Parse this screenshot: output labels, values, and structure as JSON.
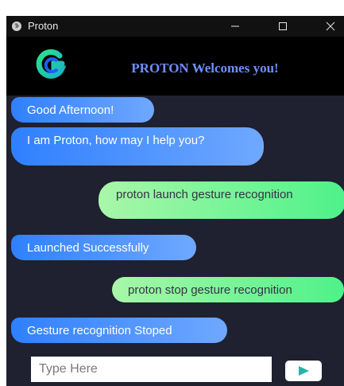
{
  "window": {
    "title": "Proton",
    "controls": {
      "minimize": "—",
      "maximize": "☐",
      "close": "✕"
    }
  },
  "header": {
    "welcome": "PROTON Welcomes you!",
    "logo_icon": "proton-logo-icon",
    "colors": {
      "welcome": "#6f8fff",
      "logo_green": "#2fe08a",
      "logo_blue": "#1e5eff"
    }
  },
  "messages": [
    {
      "sender": "bot",
      "text": "Good Afternoon!"
    },
    {
      "sender": "bot",
      "text": "I am Proton, how may I help you?"
    },
    {
      "sender": "user",
      "text": "proton launch gesture recognition"
    },
    {
      "sender": "bot",
      "text": "Launched Successfully"
    },
    {
      "sender": "user",
      "text": "proton stop gesture recognition"
    },
    {
      "sender": "bot",
      "text": "Gesture recognition Stoped"
    }
  ],
  "input": {
    "placeholder": "Type Here",
    "value": ""
  },
  "send_button": {
    "icon": "send-triangle-icon",
    "color": "#22b5a8"
  },
  "colors": {
    "background": "#1f2030",
    "bot_bubble": "#4a8dff",
    "user_bubble": "#5ef08f",
    "titlebar": "#111111",
    "header": "#000000"
  }
}
